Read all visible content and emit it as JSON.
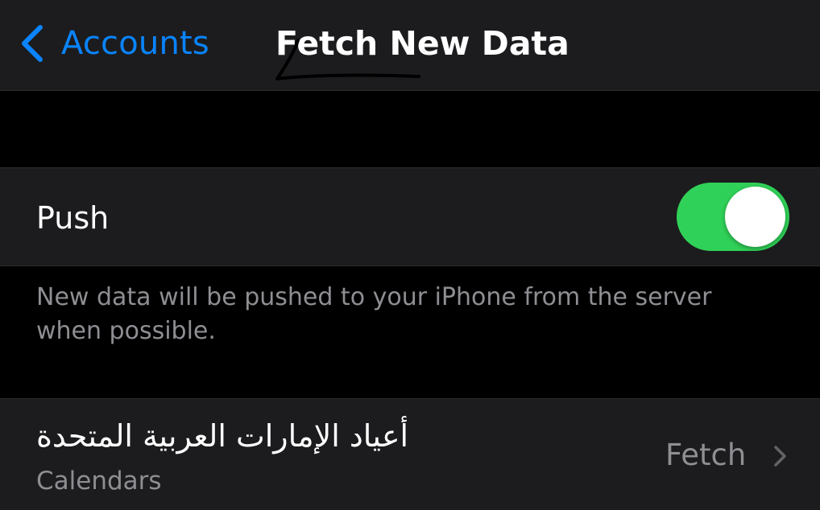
{
  "colors": {
    "accent": "#0a84ff",
    "toggle_on": "#30d158",
    "background": "#000000",
    "cell_background": "#1c1c1e",
    "secondary_text": "#8e8e93"
  },
  "navbar": {
    "back_label": "Accounts",
    "back_icon": "chevron-left-icon",
    "title": "Fetch New Data"
  },
  "push": {
    "label": "Push",
    "toggle_state": "on",
    "footer": "New data will be pushed to your iPhone from the server when possible."
  },
  "calendar_row": {
    "title": "أعياد الإمارات العربية المتحدة",
    "subtitle": "Calendars",
    "value": "Fetch",
    "chevron_icon": "chevron-right-icon"
  }
}
